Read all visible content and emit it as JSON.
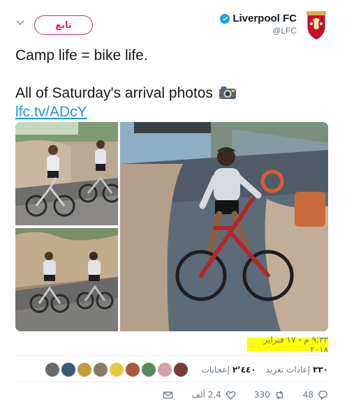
{
  "account": {
    "display_name": "Liverpool FC",
    "handle": "@LFC",
    "follow_label": "تابع",
    "avatar_icon": "liverbird-crest-icon",
    "brand_color": "#c8102e"
  },
  "tweet": {
    "line1": "Camp life = bike life.",
    "line2": "All of Saturday's arrival photos",
    "link": "lfc.tv/ADcY",
    "emoji_icon": "camera-flash-icon"
  },
  "media": {
    "photos": [
      {
        "name": "photo-top-left"
      },
      {
        "name": "photo-bottom-left"
      },
      {
        "name": "photo-main"
      }
    ]
  },
  "timestamp": "٩:٣٢ م - ١٧ فبراير ٢٠١٨",
  "stats": {
    "retweets_count": "٣٣٠",
    "retweets_label": "إعادات تغريد",
    "likes_count": "٢٬٤٤٠",
    "likes_label": "إعجابات"
  },
  "actions": {
    "reply_count": "48",
    "retweet_count": "330",
    "like_count": "2.4 ألف"
  },
  "colors": {
    "accent": "#1da1f2",
    "link": "#1b95e0",
    "follow": "#e0245e",
    "highlight": "#ffff00"
  }
}
